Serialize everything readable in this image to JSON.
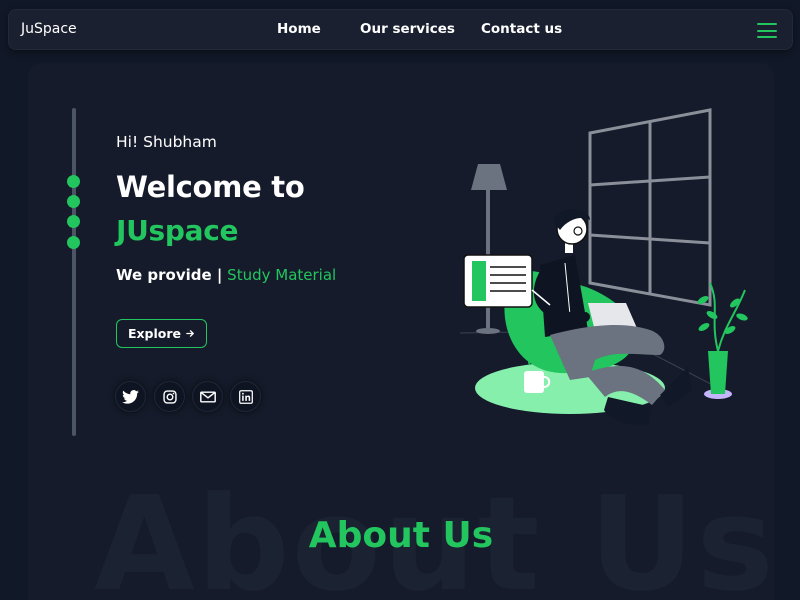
{
  "nav": {
    "brand": "JuSpace",
    "links": [
      "Home",
      "Our services",
      "Contact us"
    ],
    "menu_icon": "hamburger-icon"
  },
  "hero": {
    "greeting": "Hi!  Shubham",
    "heading": "Welcome to",
    "brand_name": "JUspace",
    "tagline_lead": "We provide |",
    "tagline_accent": "Study Material",
    "cta": "Explore",
    "cta_icon": "arrow-right-icon",
    "social_icons": [
      "twitter-icon",
      "instagram-icon",
      "mail-icon",
      "linkedin-icon"
    ]
  },
  "about": {
    "title": "About Us",
    "watermark": "About Us"
  },
  "colors": {
    "accent": "#22c55e",
    "background": "#111827",
    "card": "#151b2a"
  }
}
